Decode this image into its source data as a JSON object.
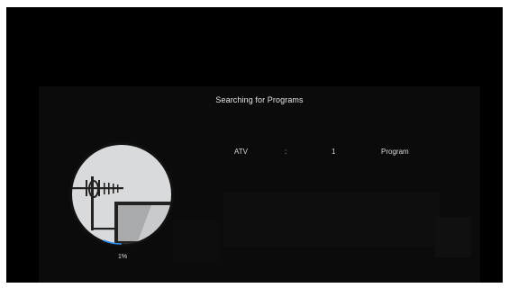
{
  "dialog": {
    "title": "Searching for Programs",
    "result_row": {
      "type": "ATV",
      "separator": ":",
      "count": "1",
      "unit": "Program"
    },
    "progress": {
      "percent_label": "1%",
      "value": 0.01
    },
    "icon": "antenna-tv-scan-icon"
  },
  "colors": {
    "background": "#000000",
    "panel": "#0b0b0b",
    "text": "#e6e6e6",
    "icon_circle": "#d9dadb",
    "progress_accent": "#2b8ef0"
  }
}
